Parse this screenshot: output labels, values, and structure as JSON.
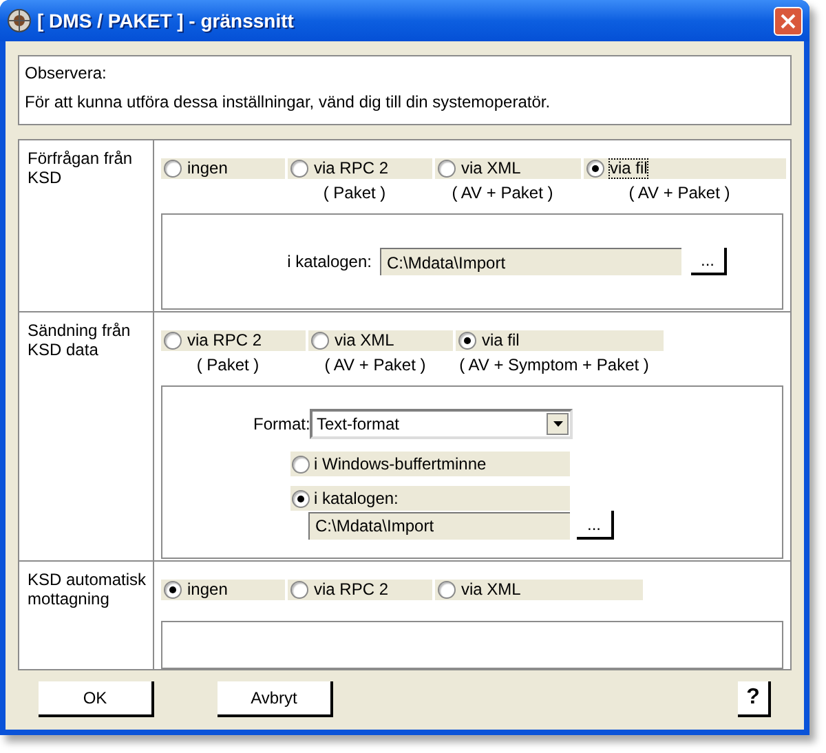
{
  "window": {
    "title": "[ DMS / PAKET ] - gränssnitt"
  },
  "notice": {
    "heading": "Observera:",
    "text": "För att kunna utföra dessa inställningar, vänd dig till din systemoperatör."
  },
  "sections": [
    {
      "label": "Förfrågan från KSD",
      "options": [
        {
          "label": "ingen",
          "selected": false,
          "focused": false
        },
        {
          "label": "via RPC 2",
          "sublabel": "( Paket )",
          "selected": false,
          "focused": false
        },
        {
          "label": "via XML",
          "sublabel": "( AV + Paket )",
          "selected": false,
          "focused": false
        },
        {
          "label": "via fil",
          "sublabel": "( AV + Paket )",
          "selected": true,
          "focused": true
        }
      ],
      "panel": {
        "kind": "folder",
        "label": "i katalogen:",
        "value": "C:\\Mdata\\Import",
        "browse": "..."
      }
    },
    {
      "label": "Sändning från KSD data",
      "options": [
        {
          "label": "via RPC 2",
          "sublabel": "( Paket )",
          "selected": false,
          "focused": false
        },
        {
          "label": "via XML",
          "sublabel": "( AV + Paket )",
          "selected": false,
          "focused": false
        },
        {
          "label": "via fil",
          "sublabel": "( AV + Symptom + Paket )",
          "selected": true,
          "focused": false
        }
      ],
      "panel": {
        "kind": "format",
        "format_label": "Format:",
        "format_value": "Text-format",
        "targets": [
          {
            "label": "i Windows-buffertminne",
            "selected": false
          },
          {
            "label": "i katalogen:",
            "selected": true,
            "path": "C:\\Mdata\\Import",
            "browse": "..."
          }
        ]
      }
    },
    {
      "label": "KSD automatisk mottagning",
      "options": [
        {
          "label": "ingen",
          "selected": true,
          "focused": false
        },
        {
          "label": "via RPC 2",
          "selected": false,
          "focused": false
        },
        {
          "label": "via XML",
          "selected": false,
          "focused": false
        }
      ],
      "panel": {
        "kind": "empty"
      }
    }
  ],
  "buttons": [
    {
      "label": "OK"
    },
    {
      "label": "Avbryt"
    }
  ],
  "help": {
    "label": "?"
  }
}
